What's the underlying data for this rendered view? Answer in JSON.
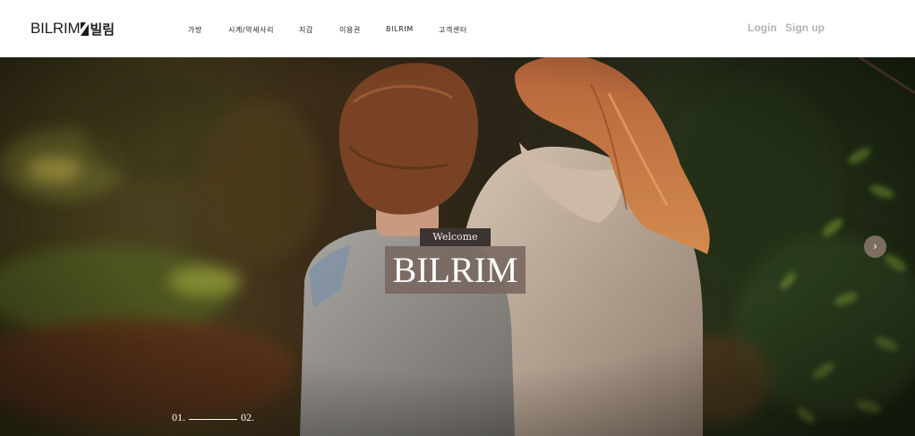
{
  "brand": {
    "logo_text": "BILRIM",
    "logo_kr": "빌림"
  },
  "nav": {
    "items": [
      {
        "label": "가방"
      },
      {
        "label": "시계/악세사리"
      },
      {
        "label": "지갑"
      },
      {
        "label": "이용권"
      },
      {
        "label": "BILRIM"
      },
      {
        "label": "고객센터"
      }
    ]
  },
  "auth": {
    "login": "Login",
    "signup": "Sign up"
  },
  "hero": {
    "welcome": "Welcome",
    "title": "BILRIM",
    "next_icon": "chevron-right-icon",
    "next_symbol": "›",
    "pager": {
      "first": "01.",
      "second": "02."
    }
  },
  "colors": {
    "header_bg": "#ffffff",
    "nav_text": "#222222",
    "auth_text": "#b3b3b3",
    "welcome_bg": "#3b3430",
    "title_bg": "#786660"
  }
}
